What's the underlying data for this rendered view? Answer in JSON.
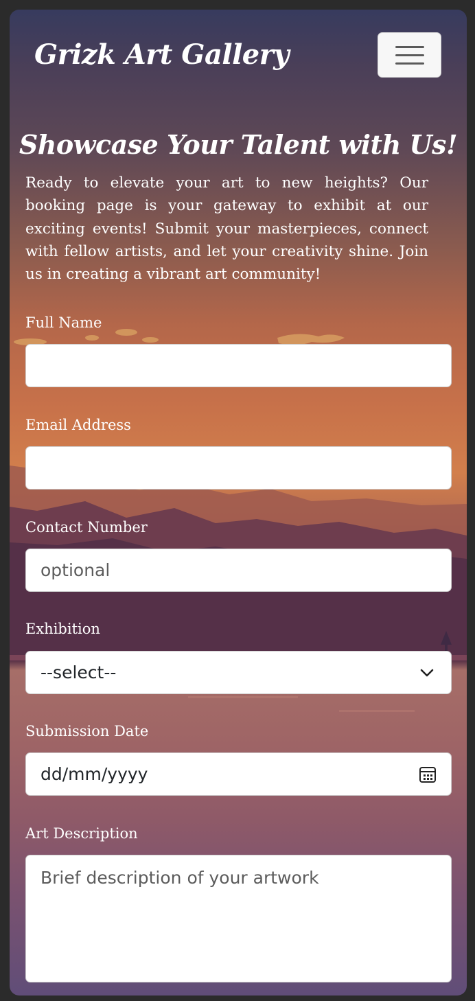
{
  "header": {
    "brand": "Grizk Art Gallery",
    "menu_icon": "hamburger-menu-icon"
  },
  "hero": {
    "title": "Showcase Your Talent with Us!",
    "intro": "Ready to elevate your art to new heights? Our booking page is your gateway to exhibit at our exciting events! Submit your masterpieces, connect with fellow artists, and let your creativity shine. Join us in creating a vibrant art community!"
  },
  "form": {
    "full_name": {
      "label": "Full Name",
      "value": "",
      "placeholder": ""
    },
    "email": {
      "label": "Email Address",
      "value": "",
      "placeholder": ""
    },
    "contact": {
      "label": "Contact Number",
      "value": "",
      "placeholder": "optional"
    },
    "exhibition": {
      "label": "Exhibition",
      "selected": "--select--",
      "icon": "chevron-down-icon"
    },
    "submission_date": {
      "label": "Submission Date",
      "value": "dd/mm/yyyy",
      "icon": "calendar-icon"
    },
    "description": {
      "label": "Art Description",
      "value": "",
      "placeholder": "Brief description of your artwork"
    }
  },
  "colors": {
    "sky_top": "#373b5e",
    "sunset_orange": "#d27f4c",
    "mountain_dark": "#553048",
    "lake": "#a66e68",
    "field_bg": "#ffffff"
  }
}
